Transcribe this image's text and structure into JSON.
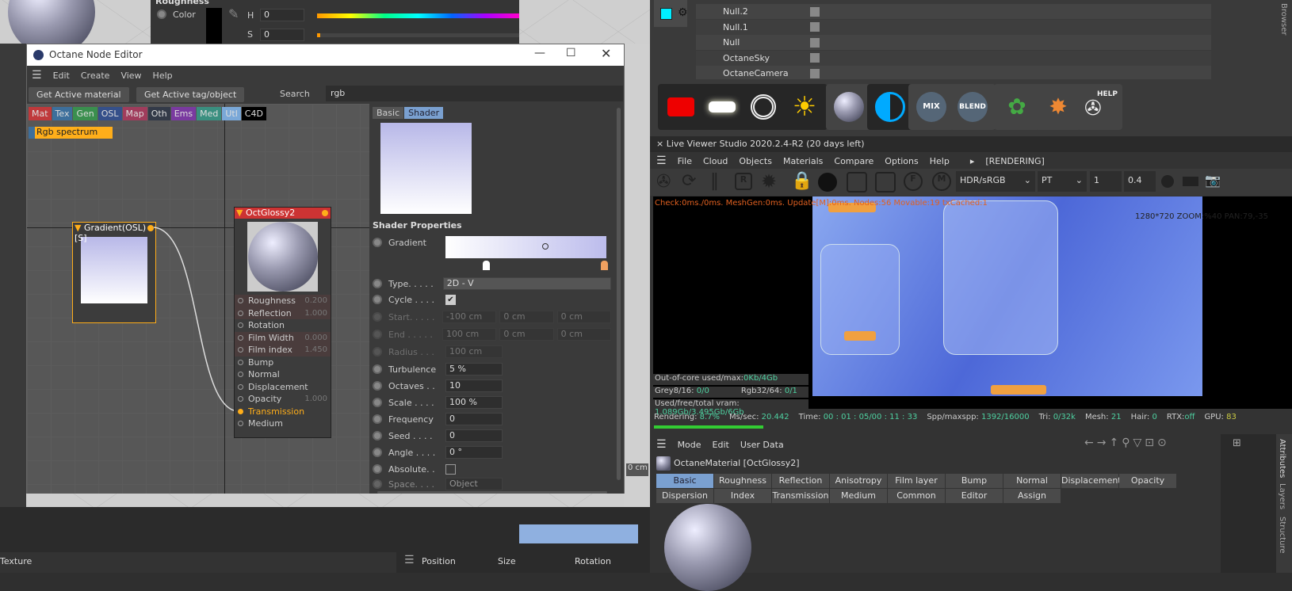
{
  "top_attr": {
    "section": "Roughness",
    "color_label": "Color",
    "h_label": "H",
    "h_value": "0",
    "s_label": "S",
    "s_value": "0"
  },
  "node_editor": {
    "title": "Octane Node Editor",
    "menu": [
      "Edit",
      "Create",
      "View",
      "Help"
    ],
    "get_active_material": "Get Active material",
    "get_active_tag": "Get Active tag/object",
    "search_label": "Search",
    "search_value": "rgb",
    "categories": [
      {
        "label": "Mat",
        "color": "#c0393b"
      },
      {
        "label": "Tex",
        "color": "#3d6f9c"
      },
      {
        "label": "Gen",
        "color": "#3a8f4e"
      },
      {
        "label": "OSL",
        "color": "#35508a"
      },
      {
        "label": "Map",
        "color": "#a03c5c"
      },
      {
        "label": "Oth",
        "color": "#333a48"
      },
      {
        "label": "Ems",
        "color": "#7a3aa0"
      },
      {
        "label": "Med",
        "color": "#3a8f80"
      },
      {
        "label": "Utl",
        "color": "#7aa8d8"
      },
      {
        "label": "C4D",
        "color": "#000000"
      }
    ],
    "search_result": "Rgb spectrum",
    "gradient_node": {
      "title": "Gradient(OSL)[S]"
    },
    "glossy_node": {
      "title": "OctGlossy2",
      "pins": [
        {
          "label": "Roughness",
          "value": "0.200"
        },
        {
          "label": "Reflection",
          "value": "1.000"
        },
        {
          "label": "Rotation",
          "value": ""
        },
        {
          "label": "Film Width",
          "value": "0.000"
        },
        {
          "label": "Film index",
          "value": "1.450"
        },
        {
          "label": "Bump",
          "value": ""
        },
        {
          "label": "Normal",
          "value": ""
        },
        {
          "label": "Displacement",
          "value": ""
        },
        {
          "label": "Opacity",
          "value": "1.000"
        },
        {
          "label": "Transmission",
          "value": ""
        },
        {
          "label": "Medium",
          "value": ""
        }
      ]
    },
    "prop_tabs": [
      "Basic",
      "Shader"
    ],
    "shader_properties": "Shader Properties",
    "gradient_label": "Gradient",
    "type_label": "Type. . . . .",
    "type_value": "2D - V",
    "cycle_label": "Cycle . . . .",
    "start": {
      "label": "Start. . . . .",
      "v": [
        "-100 cm",
        "0 cm",
        "0 cm"
      ]
    },
    "end": {
      "label": "End . . . . .",
      "v": [
        "100 cm",
        "0 cm",
        "0 cm"
      ]
    },
    "radius": {
      "label": "Radius . . .",
      "v": "100 cm"
    },
    "params": [
      {
        "label": "Turbulence",
        "value": "5 %"
      },
      {
        "label": "Octaves . .",
        "value": "10"
      },
      {
        "label": "Scale . . . .",
        "value": "100 %"
      },
      {
        "label": "Frequency",
        "value": "0"
      },
      {
        "label": "Seed . . . .",
        "value": "0"
      },
      {
        "label": "Angle . . . .",
        "value": "0 °"
      }
    ],
    "absolute_label": "Absolute. .",
    "space_label": "Space. . . .",
    "space_value": "Object"
  },
  "object_manager": {
    "rows": [
      "Null.2",
      "Null.1",
      "Null",
      "OctaneSky",
      "OctaneCamera"
    ]
  },
  "toolbar": {
    "mix": "MIX",
    "blend": "BLEND",
    "help": "HELP"
  },
  "live_viewer": {
    "title": "Live Viewer Studio 2020.2.4-R2 (20 days left)",
    "menu": [
      "File",
      "Cloud",
      "Objects",
      "Materials",
      "Compare",
      "Options",
      "Help"
    ],
    "status": "[RENDERING]",
    "color_space": "HDR/sRGB",
    "kernel": "PT",
    "v1": "1",
    "v2": "0.4",
    "overlay": "Check:0ms./0ms. MeshGen:0ms. Update[M]:0ms. Nodes:56 Movable:19 txCached:1",
    "zoom_info": "1280*720 ZOOM:%40  PAN:79,-35",
    "ooc_label": "Out-of-core used/max:",
    "ooc_val": "0Kb/4Gb",
    "grey_label": "Grey8/16: ",
    "grey_val": "0/0",
    "rgb_label": "Rgb32/64: ",
    "rgb_val": "0/1",
    "vram_label": "Used/free/total vram: ",
    "vram_val": "1.089Gb/3.495Gb/6Gb",
    "stats": [
      {
        "k": "Rendering: ",
        "v": "8.7%"
      },
      {
        "k": "Ms/sec: ",
        "v": "20.442"
      },
      {
        "k": "Time: ",
        "v": "00 : 01 : 05/00 : 11 : 33"
      },
      {
        "k": "Spp/maxspp: ",
        "v": "1392/16000"
      },
      {
        "k": "Tri: ",
        "v": "0/32k"
      },
      {
        "k": "Mesh: ",
        "v": "21"
      },
      {
        "k": "Hair: ",
        "v": "0"
      },
      {
        "k": "RTX:",
        "v": "off"
      },
      {
        "k": "GPU: ",
        "v": "83"
      }
    ],
    "progress": 8.7
  },
  "attributes": {
    "menu": [
      "Mode",
      "Edit",
      "User Data"
    ],
    "object": "OctaneMaterial [OctGlossy2]",
    "tabs1": [
      "Basic",
      "Roughness",
      "Reflection",
      "Anisotropy",
      "Film layer",
      "Bump",
      "Normal",
      "Displacement",
      "Opacity"
    ],
    "tabs2": [
      "Dispersion",
      "Index",
      "Transmission",
      "Medium",
      "Common",
      "Editor",
      "Assign"
    ]
  },
  "side_tabs": [
    "Attributes",
    "Layers",
    "Structure",
    "Browser"
  ],
  "bottom": {
    "texture": "Texture",
    "position": "Position",
    "size": "Size",
    "rotation": "Rotation",
    "cm": "0 cm"
  }
}
